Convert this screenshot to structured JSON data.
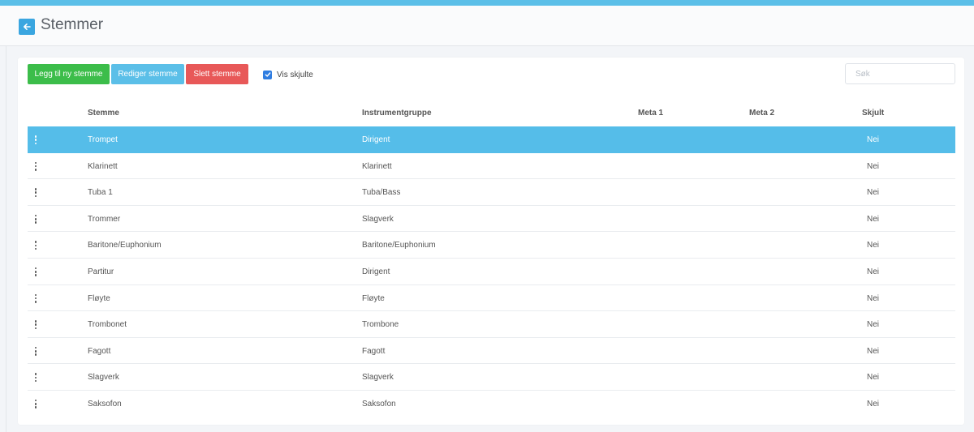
{
  "header": {
    "title": "Stemmer",
    "back_icon": "arrow-left-icon"
  },
  "toolbar": {
    "add_label": "Legg til ny stemme",
    "edit_label": "Rediger stemme",
    "delete_label": "Slett stemme",
    "show_hidden_label": "Vis skjulte",
    "show_hidden_checked": true,
    "search_placeholder": "Søk"
  },
  "colors": {
    "topbar": "#5bbfe8",
    "add_button": "#3cbd4a",
    "edit_button": "#5bbfe8",
    "delete_button": "#e85858",
    "selected_row": "#55bde9",
    "back_button": "#3aa6e0"
  },
  "table": {
    "headers": {
      "stemme": "Stemme",
      "instrumentgruppe": "Instrumentgruppe",
      "meta1": "Meta 1",
      "meta2": "Meta 2",
      "skjult": "Skjult"
    },
    "selected_index": 0,
    "rows": [
      {
        "stemme": "Trompet",
        "instrumentgruppe": "Dirigent",
        "meta1": "",
        "meta2": "",
        "skjult": "Nei"
      },
      {
        "stemme": "Klarinett",
        "instrumentgruppe": "Klarinett",
        "meta1": "",
        "meta2": "",
        "skjult": "Nei"
      },
      {
        "stemme": "Tuba 1",
        "instrumentgruppe": "Tuba/Bass",
        "meta1": "",
        "meta2": "",
        "skjult": "Nei"
      },
      {
        "stemme": "Trommer",
        "instrumentgruppe": "Slagverk",
        "meta1": "",
        "meta2": "",
        "skjult": "Nei"
      },
      {
        "stemme": "Baritone/Euphonium",
        "instrumentgruppe": "Baritone/Euphonium",
        "meta1": "",
        "meta2": "",
        "skjult": "Nei"
      },
      {
        "stemme": "Partitur",
        "instrumentgruppe": "Dirigent",
        "meta1": "",
        "meta2": "",
        "skjult": "Nei"
      },
      {
        "stemme": "Fløyte",
        "instrumentgruppe": "Fløyte",
        "meta1": "",
        "meta2": "",
        "skjult": "Nei"
      },
      {
        "stemme": "Trombonet",
        "instrumentgruppe": "Trombone",
        "meta1": "",
        "meta2": "",
        "skjult": "Nei"
      },
      {
        "stemme": "Fagott",
        "instrumentgruppe": "Fagott",
        "meta1": "",
        "meta2": "",
        "skjult": "Nei"
      },
      {
        "stemme": "Slagverk",
        "instrumentgruppe": "Slagverk",
        "meta1": "",
        "meta2": "",
        "skjult": "Nei"
      },
      {
        "stemme": "Saksofon",
        "instrumentgruppe": "Saksofon",
        "meta1": "",
        "meta2": "",
        "skjult": "Nei"
      }
    ]
  }
}
